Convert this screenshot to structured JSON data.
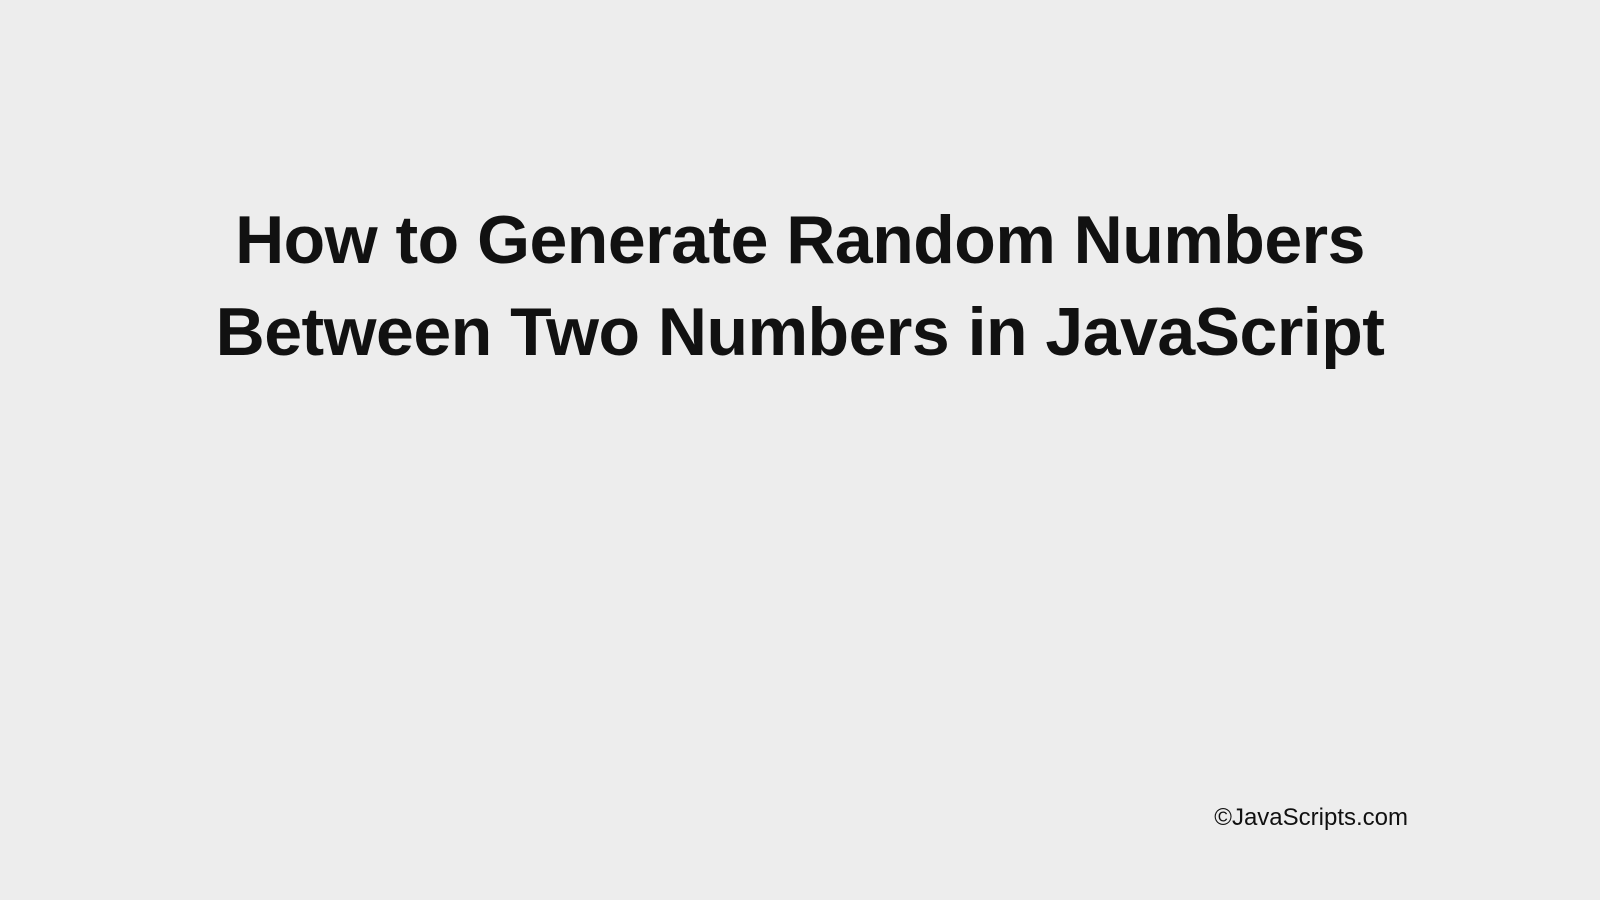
{
  "title": "How to Generate Random Numbers Between Two Numbers in JavaScript",
  "attribution": "©JavaScripts.com"
}
